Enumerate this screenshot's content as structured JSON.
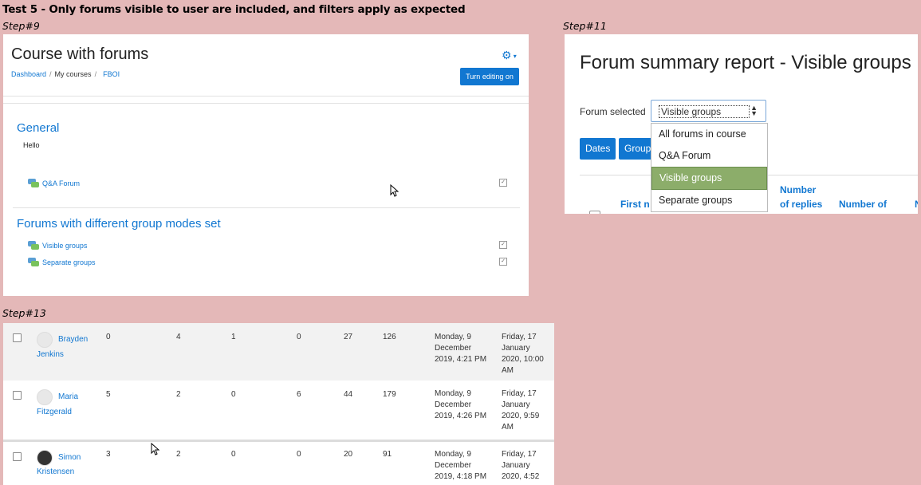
{
  "test_title": "Test 5 - Only forums visible to user are included, and filters apply as expected",
  "steps": {
    "s9": "Step#9",
    "s11": "Step#11",
    "s13": "Step#13"
  },
  "course": {
    "title": "Course with forums",
    "breadcrumb": [
      "Dashboard",
      "My courses",
      "FBOI"
    ],
    "gear_icon": "gear-icon",
    "turn_editing_label": "Turn editing on",
    "sections": [
      {
        "title": "General",
        "summary": "Hello",
        "activities": [
          "Q&A Forum"
        ]
      },
      {
        "title": "Forums with different group modes set",
        "activities": [
          "Visible groups",
          "Separate groups"
        ]
      }
    ]
  },
  "report": {
    "title": "Forum summary report - Visible groups",
    "forum_selected_label": "Forum selected",
    "select_value": "Visible groups",
    "options": [
      "All forums in course",
      "Q&A Forum",
      "Visible groups",
      "Separate groups"
    ],
    "selected_option": "Visible groups",
    "buttons": [
      "Dates",
      "Groups"
    ],
    "headers": {
      "first_name": "First n",
      "replies_1": "Number",
      "replies_2": "of replies",
      "number_of": "Number of",
      "more": "N"
    }
  },
  "table": {
    "rows": [
      {
        "first": "Brayden",
        "last": "Jenkins",
        "avatar": "default-avatar",
        "values": [
          "0",
          "4",
          "1",
          "0",
          "27",
          "126"
        ],
        "earliest": [
          "Monday, 9",
          "December",
          "2019, 4:21 PM"
        ],
        "latest": [
          "Friday, 17",
          "January",
          "2020, 10:00",
          "AM"
        ]
      },
      {
        "first": "Maria",
        "last": "Fitzgerald",
        "avatar": "default-avatar",
        "values": [
          "5",
          "2",
          "0",
          "6",
          "44",
          "179"
        ],
        "earliest": [
          "Monday, 9",
          "December",
          "2019, 4:26 PM"
        ],
        "latest": [
          "Friday, 17",
          "January",
          "2020, 9:59",
          "AM"
        ]
      },
      {
        "first": "Simon",
        "last": "Kristensen",
        "avatar": "photo-avatar",
        "values": [
          "3",
          "2",
          "0",
          "0",
          "20",
          "91"
        ],
        "earliest": [
          "Monday, 9",
          "December",
          "2019, 4:18 PM"
        ],
        "latest": [
          "Friday, 17",
          "January",
          "2020, 4:52"
        ]
      }
    ]
  },
  "colors": {
    "background": "#e4b8b8",
    "link": "#1177d1",
    "selected_option": "#8cad6a"
  }
}
